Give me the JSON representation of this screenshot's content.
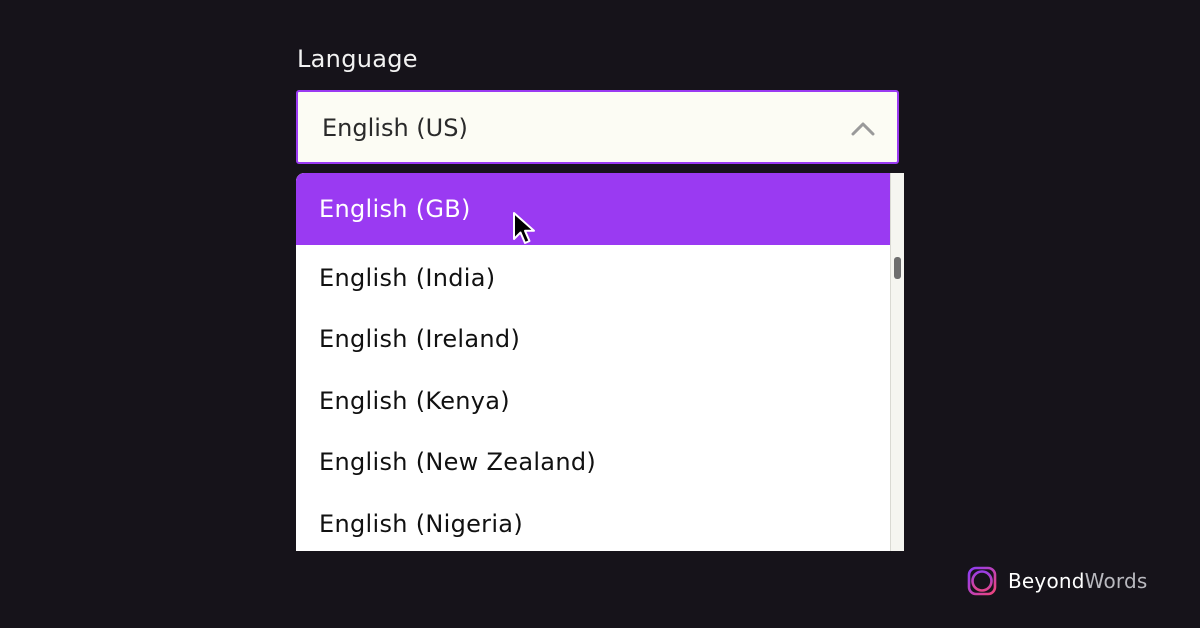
{
  "field": {
    "label": "Language",
    "selected_value": "English (US)"
  },
  "dropdown": {
    "options": [
      {
        "label": "English (GB)",
        "highlighted": true
      },
      {
        "label": "English (India)",
        "highlighted": false
      },
      {
        "label": "English (Ireland)",
        "highlighted": false
      },
      {
        "label": "English (Kenya)",
        "highlighted": false
      },
      {
        "label": "English (New Zealand)",
        "highlighted": false
      },
      {
        "label": "English (Nigeria)",
        "highlighted": false
      }
    ]
  },
  "brand": {
    "name_bold": "Beyond",
    "name_light": "Words",
    "logo_icon": "beyondwords-logo-icon"
  },
  "colors": {
    "background": "#16131a",
    "accent": "#9a3af2",
    "field_bg": "#fcfcf4"
  }
}
